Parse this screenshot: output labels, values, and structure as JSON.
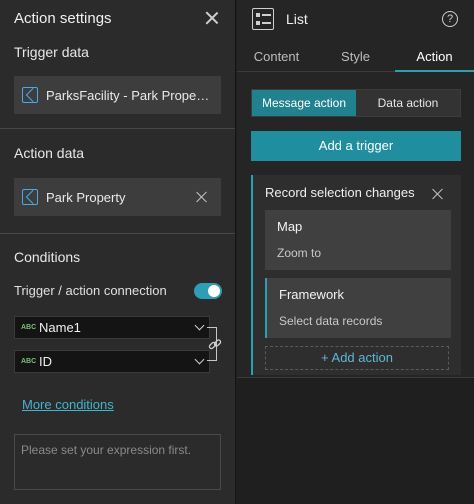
{
  "left_panel": {
    "title": "Action settings",
    "trigger_data": {
      "label": "Trigger data",
      "value": "ParksFacility - Park Property ..."
    },
    "action_data": {
      "label": "Action data",
      "value": "Park Property"
    },
    "conditions": {
      "label": "Conditions",
      "connection_label": "Trigger / action connection",
      "connection_enabled": true,
      "fields": [
        {
          "type_badge": "ABC",
          "value": "Name1"
        },
        {
          "type_badge": "ABC",
          "value": "ID"
        }
      ],
      "more_conditions": "More conditions",
      "expression_placeholder": "Please set your expression first."
    }
  },
  "right_panel": {
    "title": "List",
    "tabs": [
      {
        "label": "Content",
        "active": false
      },
      {
        "label": "Style",
        "active": false
      },
      {
        "label": "Action",
        "active": true
      }
    ],
    "segments": [
      {
        "label": "Message action",
        "active": true
      },
      {
        "label": "Data action",
        "active": false
      }
    ],
    "add_trigger": "Add a trigger",
    "trigger": {
      "title": "Record selection changes",
      "actions": [
        {
          "name": "Map",
          "description": "Zoom to"
        },
        {
          "name": "Framework",
          "description": "Select data records"
        }
      ],
      "add_action": "+ Add action"
    }
  },
  "colors": {
    "accent": "#2a9fb5",
    "button": "#1f8f9f",
    "link": "#3fb6cf"
  }
}
